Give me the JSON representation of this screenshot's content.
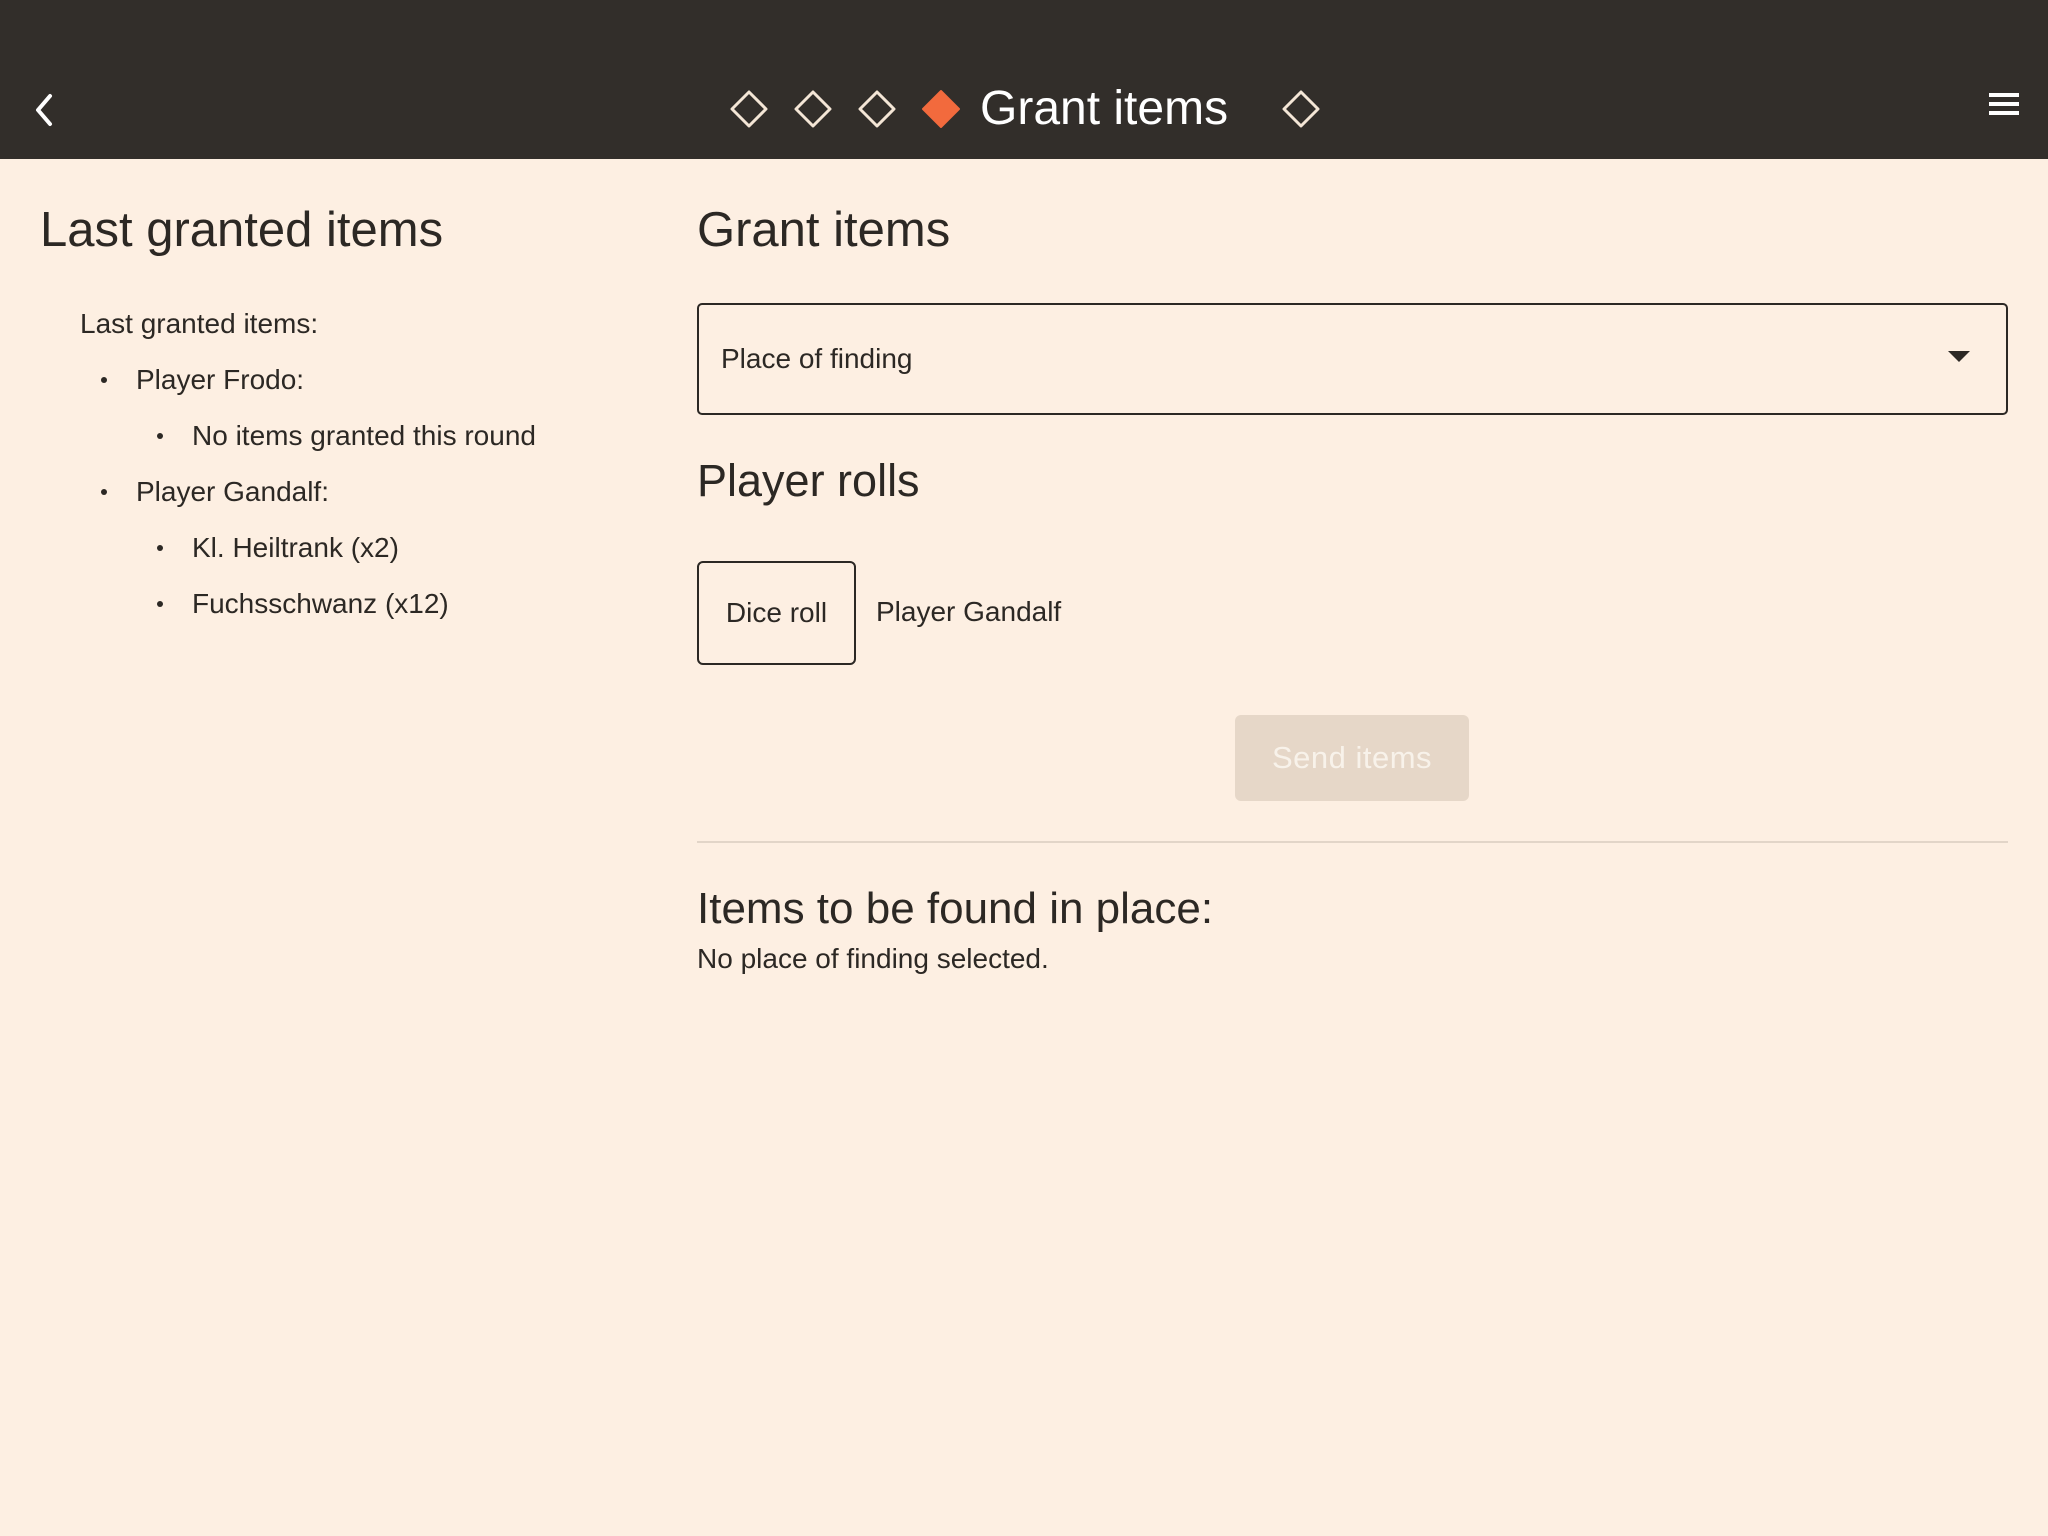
{
  "header": {
    "title": "Grant items",
    "steps": [
      {
        "icon": "diamond-outline-icon",
        "active": false
      },
      {
        "icon": "diamond-outline-icon",
        "active": false
      },
      {
        "icon": "diamond-outline-icon",
        "active": false
      },
      {
        "icon": "diamond-filled-icon",
        "active": true
      },
      {
        "icon": "diamond-outline-icon",
        "active": false
      }
    ],
    "back_icon": "chevron-left-icon",
    "menu_icon": "hamburger-menu-icon",
    "active_color": "#f26a3d"
  },
  "left_panel": {
    "title": "Last granted items",
    "label": "Last granted items:",
    "players": [
      {
        "name": "Player Frodo:",
        "items": [
          "No items granted this round"
        ]
      },
      {
        "name": "Player Gandalf:",
        "items": [
          "Kl. Heiltrank (x2)",
          "Fuchsschwanz (x12)"
        ]
      }
    ]
  },
  "main": {
    "title": "Grant items",
    "place_select": {
      "value": "Place of finding"
    },
    "rolls_title": "Player rolls",
    "dice_button": "Dice roll",
    "player": "Player Gandalf",
    "send_button": "Send items",
    "found_title": "Items to be found in place:",
    "found_empty": "No place of finding selected."
  }
}
